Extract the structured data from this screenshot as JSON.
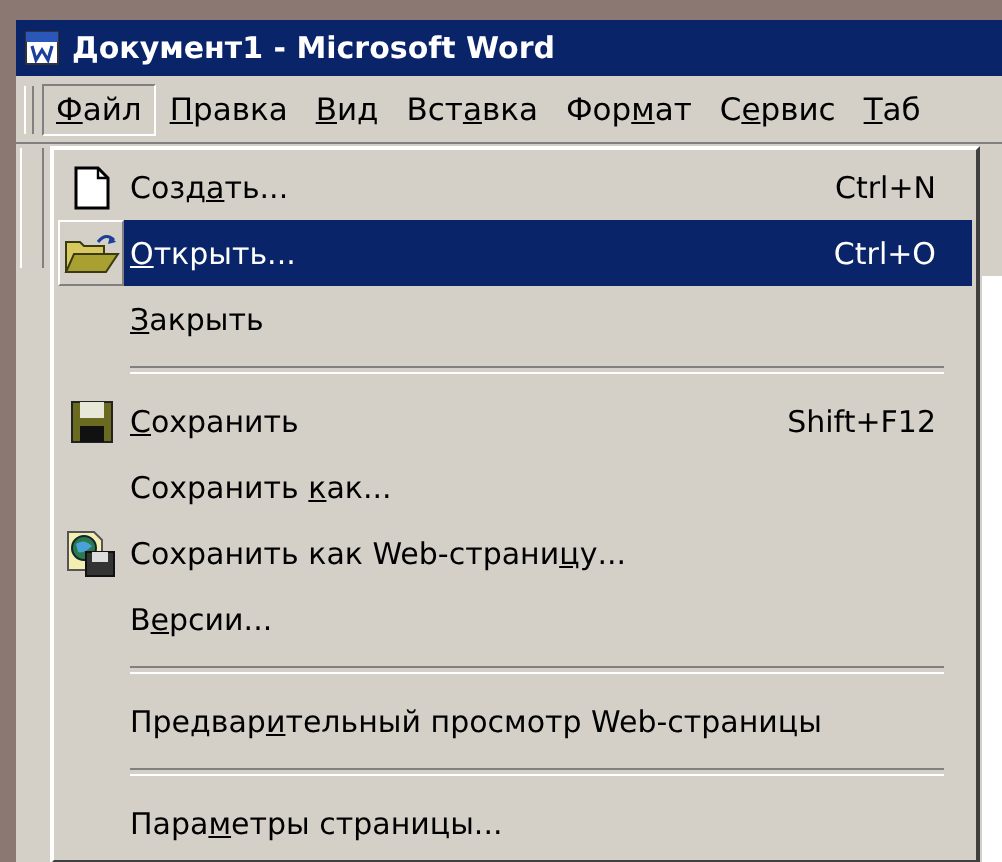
{
  "window": {
    "title": "Документ1 - Microsoft Word"
  },
  "menubar": [
    {
      "key": "Ф",
      "post": "айл",
      "selected": true
    },
    {
      "key": "П",
      "post": "равка",
      "selected": false
    },
    {
      "key": "В",
      "post": "ид",
      "selected": false
    },
    {
      "pre": "Вст",
      "key": "а",
      "post": "вка",
      "selected": false
    },
    {
      "pre": "Фор",
      "key": "м",
      "post": "ат",
      "selected": false
    },
    {
      "pre": "С",
      "key": "е",
      "post": "рвис",
      "selected": false
    },
    {
      "key": "Т",
      "post": "аб",
      "selected": false
    }
  ],
  "file_menu": [
    {
      "kind": "item",
      "pre": "Созд",
      "key": "а",
      "post": "ть...",
      "shortcut": "Ctrl+N",
      "selected": false
    },
    {
      "kind": "item",
      "key": "О",
      "post": "ткрыть...",
      "shortcut": "Ctrl+O",
      "selected": true
    },
    {
      "kind": "item",
      "key": "З",
      "post": "акрыть",
      "selected": false
    },
    {
      "kind": "separator"
    },
    {
      "kind": "item",
      "key": "С",
      "post": "охранить",
      "shortcut": "Shift+F12",
      "selected": false
    },
    {
      "kind": "item",
      "pre": "Сохранить ",
      "key": "к",
      "post": "ак...",
      "selected": false
    },
    {
      "kind": "item",
      "pre": "Сохранить как Web-страни",
      "key": "ц",
      "post": "у...",
      "selected": false
    },
    {
      "kind": "item",
      "pre": "В",
      "key": "е",
      "post": "рсии...",
      "selected": false
    },
    {
      "kind": "separator"
    },
    {
      "kind": "item",
      "pre": "Предвар",
      "key": "и",
      "post": "тельный просмотр Web-страницы",
      "selected": false
    },
    {
      "kind": "separator"
    },
    {
      "kind": "item",
      "pre": "Пара",
      "key": "м",
      "post": "етры страницы...",
      "selected": false
    }
  ]
}
